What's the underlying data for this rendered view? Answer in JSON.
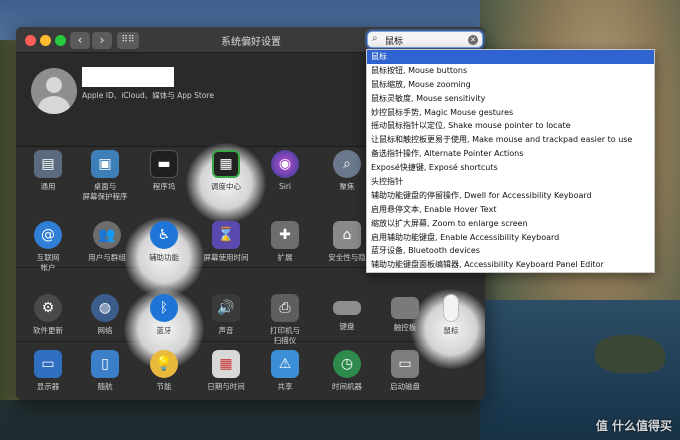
{
  "window": {
    "title": "系统偏好设置",
    "nav_back": "‹",
    "nav_forward": "›",
    "grid_button": "⠿⠿"
  },
  "user": {
    "subtitle": "Apple ID、iCloud、媒体与 App Store"
  },
  "search": {
    "value": "鼠标"
  },
  "results": [
    "鼠标",
    "鼠标按钮, Mouse buttons",
    "鼠标缩放, Mouse zooming",
    "鼠标灵敏度, Mouse sensitivity",
    "妙控鼠标手势, Magic Mouse gestures",
    "摇动鼠标指针以定位, Shake mouse pointer to locate",
    "让鼠标和触控板更易于使用, Make mouse and trackpad easier to use",
    "备选指针操作, Alternate Pointer Actions",
    "Exposé快捷键, Exposé shortcuts",
    "头控指针",
    "辅助功能键盘的停留操作, Dwell for Accessibility Keyboard",
    "启用悬停文本, Enable Hover Text",
    "缩放以扩大屏幕, Zoom to enlarge screen",
    "启用辅助功能键盘, Enable Accessibility Keyboard",
    "蓝牙设备, Bluetooth devices",
    "辅助功能键盘面板编辑器, Accessibility Keyboard Panel Editor"
  ],
  "panes": {
    "general": "通用",
    "desktop": "桌面与\n屏幕保护程序",
    "dock": "程序坞",
    "mission": "调度中心",
    "siri": "Siri",
    "spotlight": "聚焦",
    "internet": "互联网\n帐户",
    "users": "用户与群组",
    "accessibility": "辅助功能",
    "screentime": "屏幕使用时间",
    "extensions": "扩展",
    "security": "安全性与隐",
    "software": "软件更新",
    "network": "网络",
    "bluetooth": "蓝牙",
    "sound": "声音",
    "printers": "打印机与\n扫描仪",
    "keyboard": "键盘",
    "trackpad": "触控板",
    "mouse": "鼠标",
    "displays": "显示器",
    "sidecar": "随航",
    "energy": "节能",
    "datetime": "日期与时间",
    "sharing": "共享",
    "timemachine": "时间机器",
    "startup": "启动磁盘"
  },
  "watermark": "值 什么值得买",
  "colors": {
    "selection": "#2e63d1",
    "window_bg": "#2e2e2e",
    "titlebar": "#3a3a3a"
  }
}
